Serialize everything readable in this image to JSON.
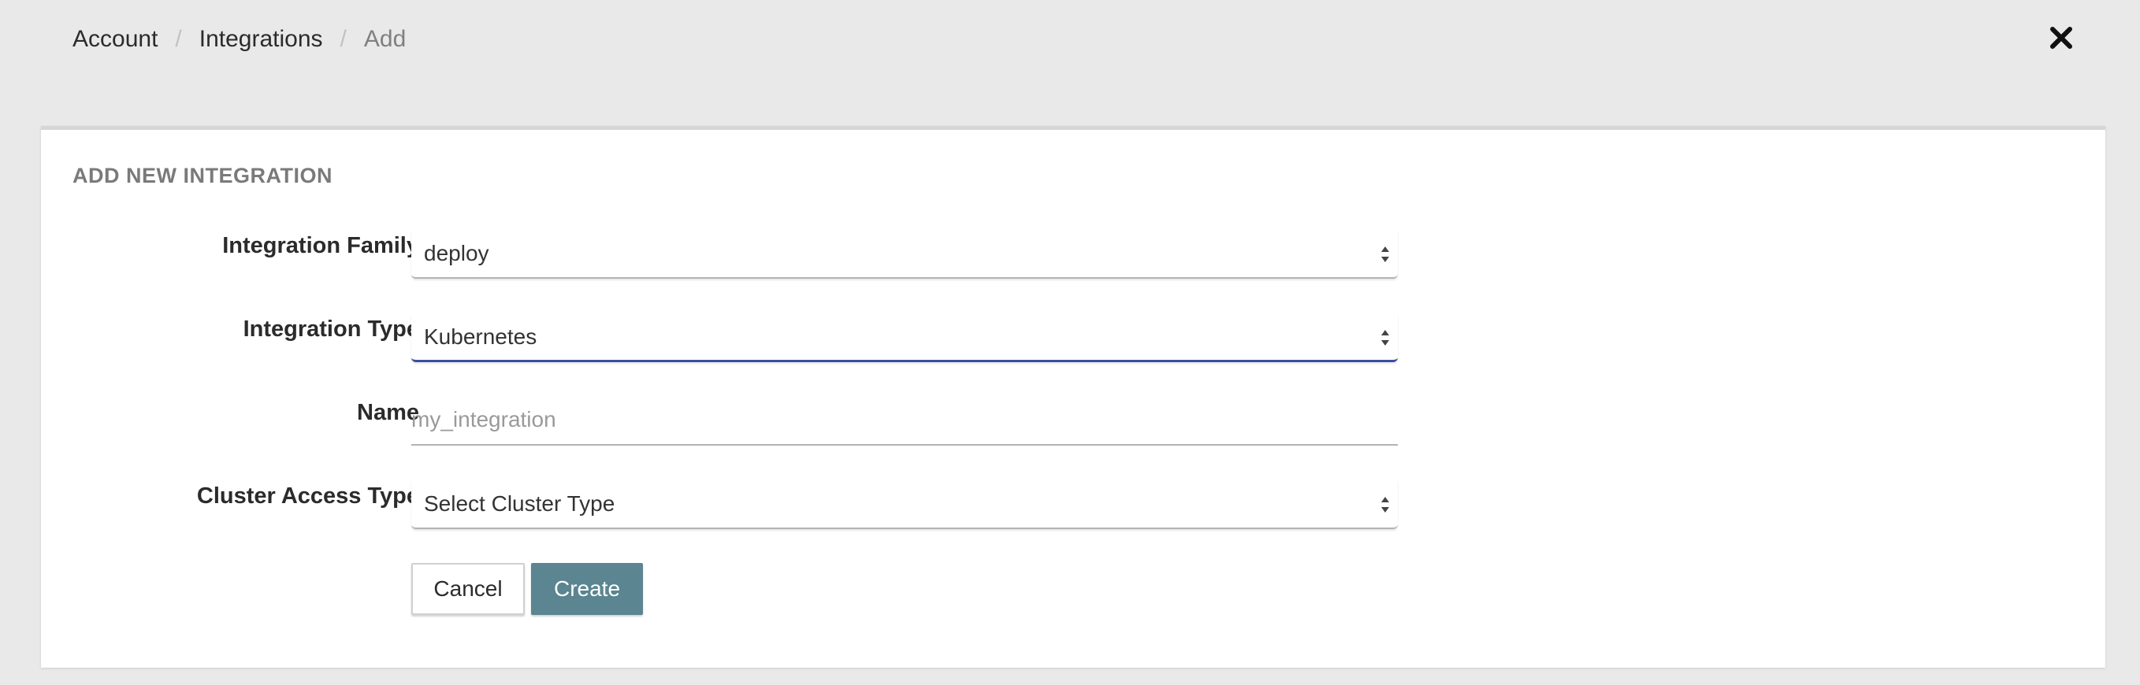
{
  "breadcrumb": {
    "items": [
      "Account",
      "Integrations"
    ],
    "separator": "/",
    "current": "Add"
  },
  "close_icon": "close-icon",
  "form": {
    "title": "ADD NEW INTEGRATION",
    "integration_family": {
      "label": "Integration Family",
      "value": "deploy"
    },
    "integration_type": {
      "label": "Integration Type",
      "value": "Kubernetes"
    },
    "name": {
      "label": "Name",
      "value": "",
      "placeholder": "my_integration"
    },
    "cluster_access_type": {
      "label": "Cluster Access Type",
      "value": "Select Cluster Type"
    },
    "cancel_label": "Cancel",
    "create_label": "Create"
  },
  "colors": {
    "background": "#e9e9e9",
    "card": "#ffffff",
    "focus_underline": "#3d4ea0",
    "primary_button": "#5b8590"
  }
}
